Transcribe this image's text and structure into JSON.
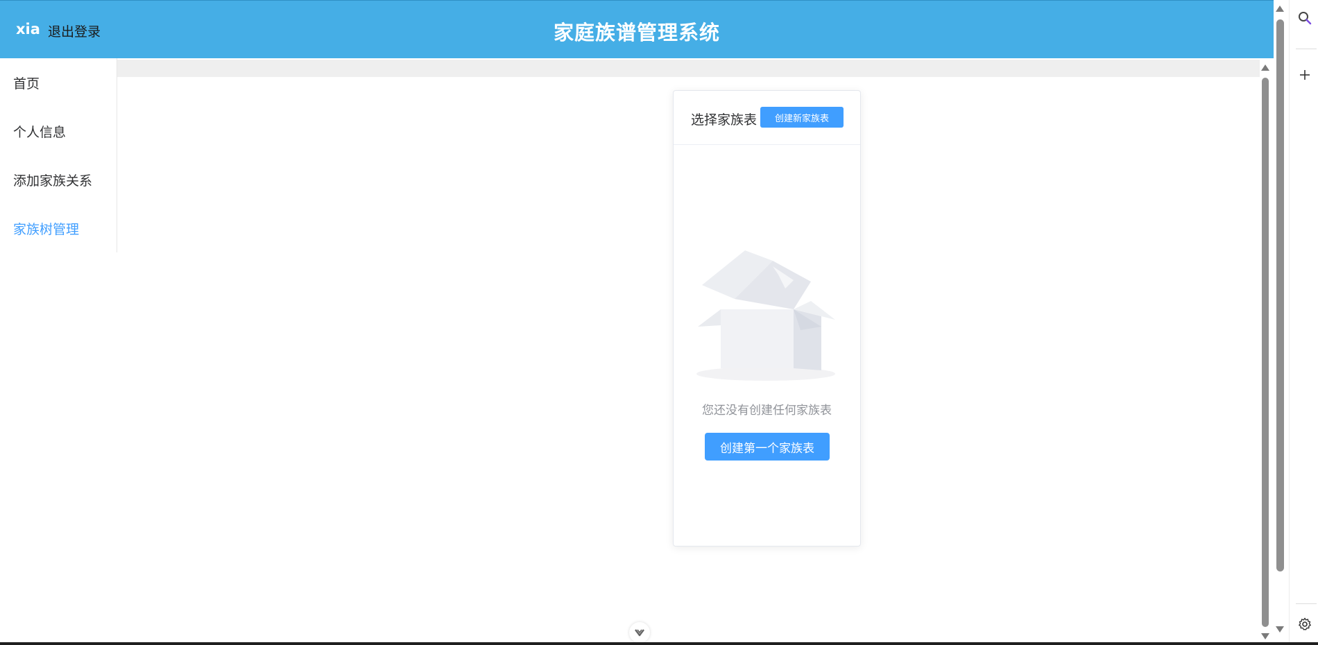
{
  "header": {
    "username": "xia",
    "logout_label": "退出登录",
    "title": "家庭族谱管理系统"
  },
  "sidebar": {
    "items": [
      {
        "label": "首页",
        "active": false
      },
      {
        "label": "个人信息",
        "active": false
      },
      {
        "label": "添加家族关系",
        "active": false
      },
      {
        "label": "家族树管理",
        "active": true
      }
    ]
  },
  "card": {
    "title": "选择家族表",
    "new_button": "创建新家族表",
    "empty_text": "您还没有创建任何家族表",
    "first_button": "创建第一个家族表"
  },
  "right_rail": {
    "icons": [
      "search-icon",
      "plus-icon",
      "gear-icon"
    ]
  },
  "colors": {
    "header_bg": "#45aee6",
    "accent": "#409eff",
    "muted_text": "#909399"
  }
}
